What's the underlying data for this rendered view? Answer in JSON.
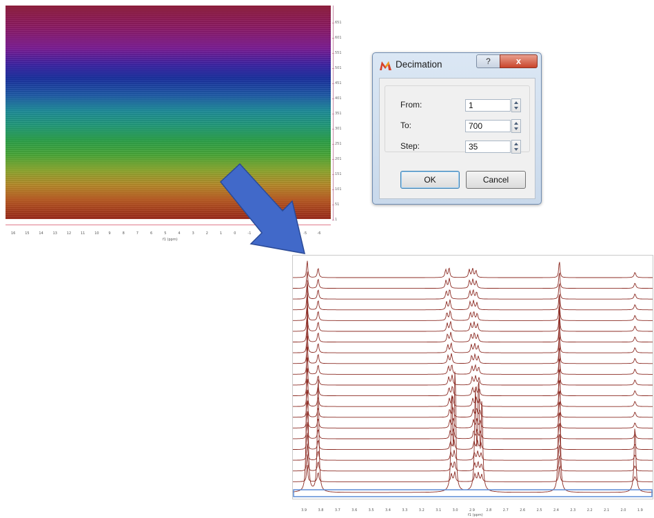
{
  "heatmap": {
    "y_ticks": [
      "651",
      "601",
      "551",
      "501",
      "451",
      "401",
      "351",
      "301",
      "251",
      "201",
      "151",
      "101",
      "51",
      "1"
    ],
    "x_ticks": [
      "16",
      "15",
      "14",
      "13",
      "12",
      "11",
      "10",
      "9",
      "8",
      "7",
      "6",
      "5",
      "4",
      "3",
      "2",
      "1",
      "0",
      "-1",
      "-2",
      "-3",
      "-4",
      "-5",
      "-6"
    ],
    "x_label": "f1 (ppm)",
    "colors": [
      "#8e1c3a",
      "#7b1c93",
      "#1a2f9e",
      "#1e8a9a",
      "#2a9f4a",
      "#8aa72f",
      "#b85a22",
      "#9a2a1c"
    ]
  },
  "dialog": {
    "title": "Decimation",
    "icon": "app-logo-icon",
    "help_label": "?",
    "close_label": "x",
    "fields": {
      "from": {
        "label": "From:",
        "value": "1"
      },
      "to": {
        "label": "To:",
        "value": "700"
      },
      "step": {
        "label": "Step:",
        "value": "35"
      }
    },
    "ok_label": "OK",
    "cancel_label": "Cancel"
  },
  "arrow": {
    "icon": "arrow-icon",
    "color": "#4169c9"
  },
  "stack": {
    "x_ticks": [
      "3.9",
      "3.8",
      "3.7",
      "3.6",
      "3.5",
      "3.4",
      "3.3",
      "3.2",
      "3.1",
      "3.0",
      "2.9",
      "2.8",
      "2.7",
      "2.6",
      "2.5",
      "2.4",
      "2.3",
      "2.2",
      "2.1",
      "2.0",
      "1.9"
    ],
    "x_label": "f1 (ppm)",
    "trace_color": "#8b2a22",
    "highlight_color": "#5a8bd6"
  }
}
